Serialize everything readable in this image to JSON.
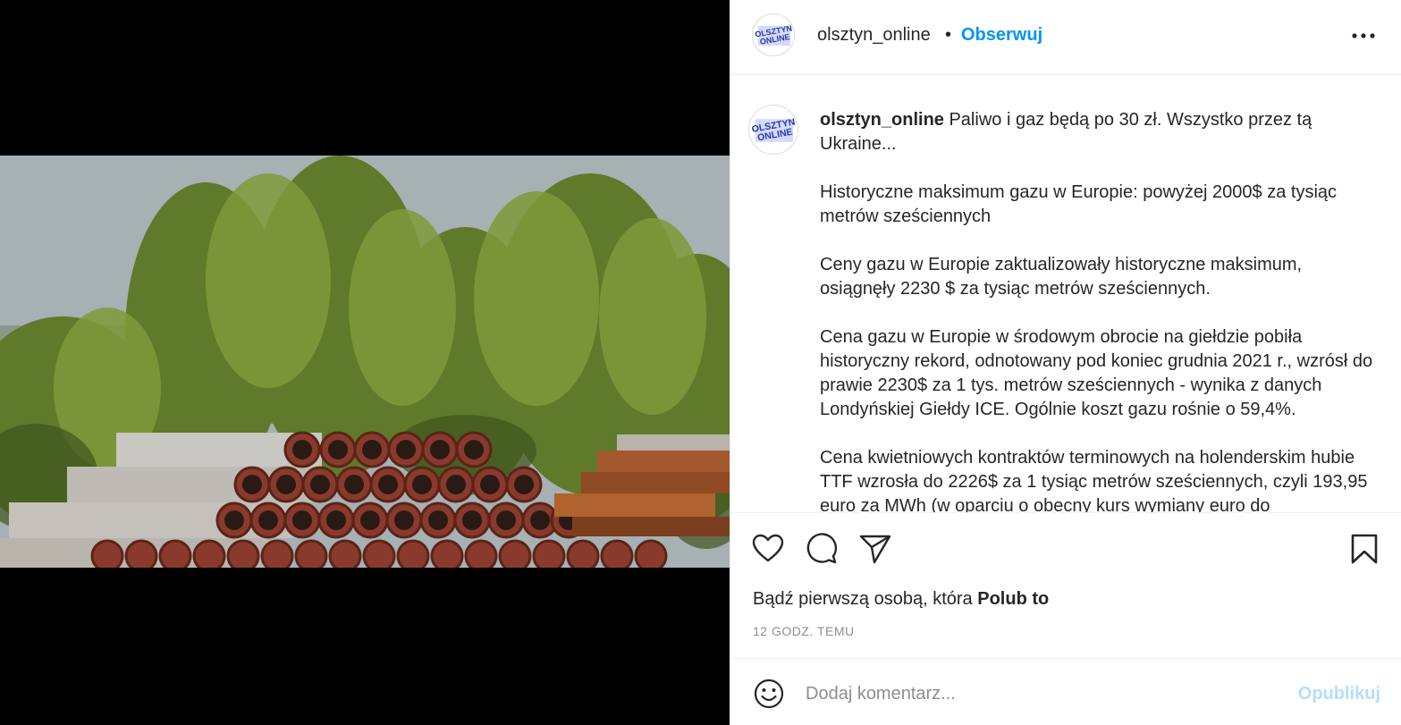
{
  "post": {
    "username": "olsztyn_online",
    "separator": "•",
    "follow_label": "Obserwuj",
    "avatar_text_top": "OLSZTYN",
    "avatar_text_bottom": "ONLINE"
  },
  "caption": {
    "username": "olsztyn_online",
    "paragraphs": [
      "Paliwo i gaz będą po 30 zł. Wszystko przez tą Ukraine...",
      "Historyczne maksimum gazu w Europie: powyżej 2000$ za tysiąc metrów sześciennych",
      "Ceny gazu w Europie zaktualizowały historyczne maksimum, osiągnęły 2230 $ za tysiąc metrów sześciennych.",
      "Cena gazu w Europie w środowym obrocie na giełdzie pobiła historyczny rekord, odnotowany pod koniec grudnia 2021 r., wzrósł do prawie 2230$ za 1 tys. metrów sześciennych - wynika z danych Londyńskiej Giełdy ICE. Ogólnie koszt gazu rośnie o 59,4%.",
      "Cena kwietniowych kontraktów terminowych na holenderskim hubie TTF wzrosła do 2226$ za 1 tysiąc metrów sześciennych, czyli 193,95 euro za MWh (w oparciu o obecny kurs wymiany euro do"
    ]
  },
  "likes": {
    "prefix": "Bądź pierwszą osobą, która ",
    "link": "Polub to"
  },
  "timestamp": "12 GODZ. TEMU",
  "comment": {
    "placeholder": "Dodaj komentarz...",
    "publish_label": "Opublikuj"
  },
  "icons": {
    "like": "heart-icon",
    "comment": "comment-icon",
    "share": "paper-plane-icon",
    "save": "bookmark-icon",
    "more": "more-options-icon",
    "emoji": "emoji-icon"
  },
  "colors": {
    "accent": "#0095f6",
    "publish_disabled": "#b2dffc",
    "muted": "#8e8e8e"
  }
}
